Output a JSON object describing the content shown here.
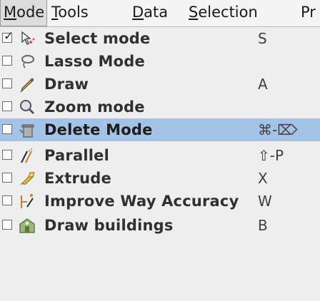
{
  "menubar": {
    "mode": {
      "label_first": "M",
      "label_rest": "ode"
    },
    "tools": {
      "label_first": "T",
      "label_rest": "ools"
    },
    "data": {
      "label_first": "D",
      "label_rest": "ata"
    },
    "selection": {
      "label_first": "S",
      "label_rest": "election"
    },
    "preset": {
      "label_partial": "Pr"
    }
  },
  "menu_items": [
    {
      "label": "Select mode",
      "shortcut": "S",
      "checked": true,
      "icon": "select-mode-icon"
    },
    {
      "label": "Lasso Mode",
      "shortcut": "",
      "checked": false,
      "icon": "lasso-icon"
    },
    {
      "label": "Draw",
      "shortcut": "A",
      "checked": false,
      "icon": "draw-pencil-icon"
    },
    {
      "label": "Zoom mode",
      "shortcut": "",
      "checked": false,
      "icon": "zoom-magnifier-icon"
    },
    {
      "label": "Delete Mode",
      "shortcut": "⌘-⌦",
      "checked": false,
      "icon": "delete-mode-icon"
    },
    {
      "label": "Parallel",
      "shortcut": "⇧-P",
      "checked": false,
      "icon": "parallel-icon"
    },
    {
      "label": "Extrude",
      "shortcut": "X",
      "checked": false,
      "icon": "extrude-icon"
    },
    {
      "label": "Improve Way Accuracy",
      "shortcut": "W",
      "checked": false,
      "icon": "improve-accuracy-icon"
    },
    {
      "label": "Draw buildings",
      "shortcut": "B",
      "checked": false,
      "icon": "building-icon"
    }
  ],
  "highlighted_item": "Delete Mode",
  "colors": {
    "highlight": "#a4c3e7",
    "menu_bg": "#eeeeee",
    "label": "#303030"
  }
}
